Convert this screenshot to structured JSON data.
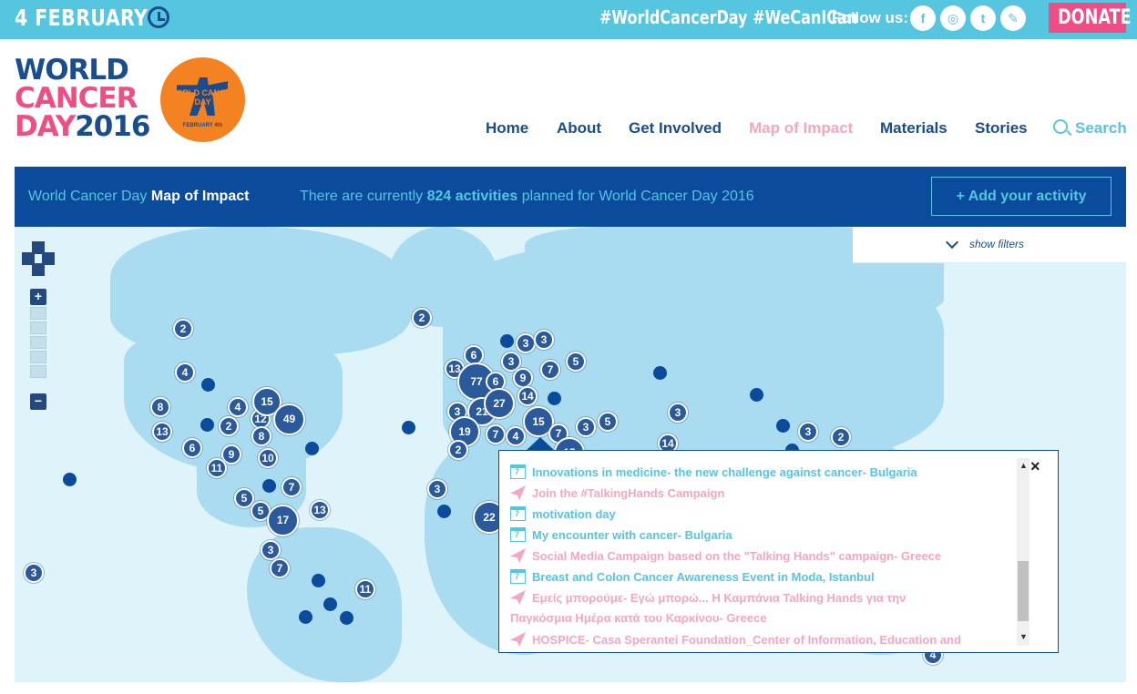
{
  "topbar": {
    "date": "4 FEBRUARY",
    "hashtag1": "#WorldCancerDay",
    "hashtag2": "#WeCanICan",
    "follow_label": "Follow us:",
    "social": [
      {
        "name": "facebook-icon",
        "glyph": "f"
      },
      {
        "name": "instagram-icon",
        "glyph": "◎"
      },
      {
        "name": "twitter-icon",
        "glyph": "t"
      },
      {
        "name": "blog-icon",
        "glyph": "✎"
      }
    ],
    "donate": "DONATE"
  },
  "logo": {
    "line1": "WORLD",
    "line2": "CANCER",
    "line3a": "DAY",
    "line3b": "2016",
    "badge_text": "WORLD CANCER DAY",
    "badge_sub": "FEBRUARY 4th"
  },
  "nav": {
    "items": [
      "Home",
      "About",
      "Get Involved",
      "Map of Impact",
      "Materials",
      "Stories"
    ],
    "search": "Search"
  },
  "band": {
    "title_prefix": "World Cancer Day",
    "title_bold": "Map of Impact",
    "info_prefix": "There are currently",
    "info_bold": "824 activities",
    "info_suffix": "planned for World Cancer Day 2016",
    "add_button": "+ Add your activity"
  },
  "filters": {
    "label": "show filters"
  },
  "zoom": {
    "plus": "+",
    "minus": "−"
  },
  "markers": [
    "2",
    "4",
    "8",
    "4",
    "13",
    "2",
    "12",
    "15",
    "49",
    "8",
    "6",
    "9",
    "10",
    "11",
    "7",
    "5",
    "5",
    "17",
    "13",
    "3",
    "7",
    "11",
    "3",
    "2",
    "6",
    "13",
    "77",
    "6",
    "3",
    "3",
    "3",
    "9",
    "7",
    "5",
    "14",
    "3",
    "21",
    "27",
    "19",
    "7",
    "4",
    "15",
    "3",
    "5",
    "7",
    "15",
    "2",
    "3",
    "22",
    "14",
    "3",
    "3",
    "2",
    "4",
    "3"
  ],
  "popup": {
    "items": [
      {
        "type": "event",
        "text": "Innovations in medicine- the new challenge against cancer- Bulgaria"
      },
      {
        "type": "campaign",
        "text": "Join the #TalkingHands Campaign"
      },
      {
        "type": "event",
        "text": "motivation day"
      },
      {
        "type": "event",
        "text": "My encounter with cancer- Bulgaria"
      },
      {
        "type": "campaign",
        "text": "Social Media Campaign based on the \"Talking Hands\" campaign- Greece"
      },
      {
        "type": "event",
        "text": "Breast and Colon Cancer Awareness Event in Moda, Istanbul"
      },
      {
        "type": "campaign",
        "text": "Εμείς μπορούμε- Εγώ μπορώ... Η Καμπάνια Talking Hands για την"
      },
      {
        "type": "campaign",
        "text": "HOSPICE- Casa Sperantei Foundation_Center of Information, Education and"
      }
    ],
    "continuation": "Παγκόσμια Ημέρα κατά του Καρκίνου- Greece",
    "close": "×"
  }
}
